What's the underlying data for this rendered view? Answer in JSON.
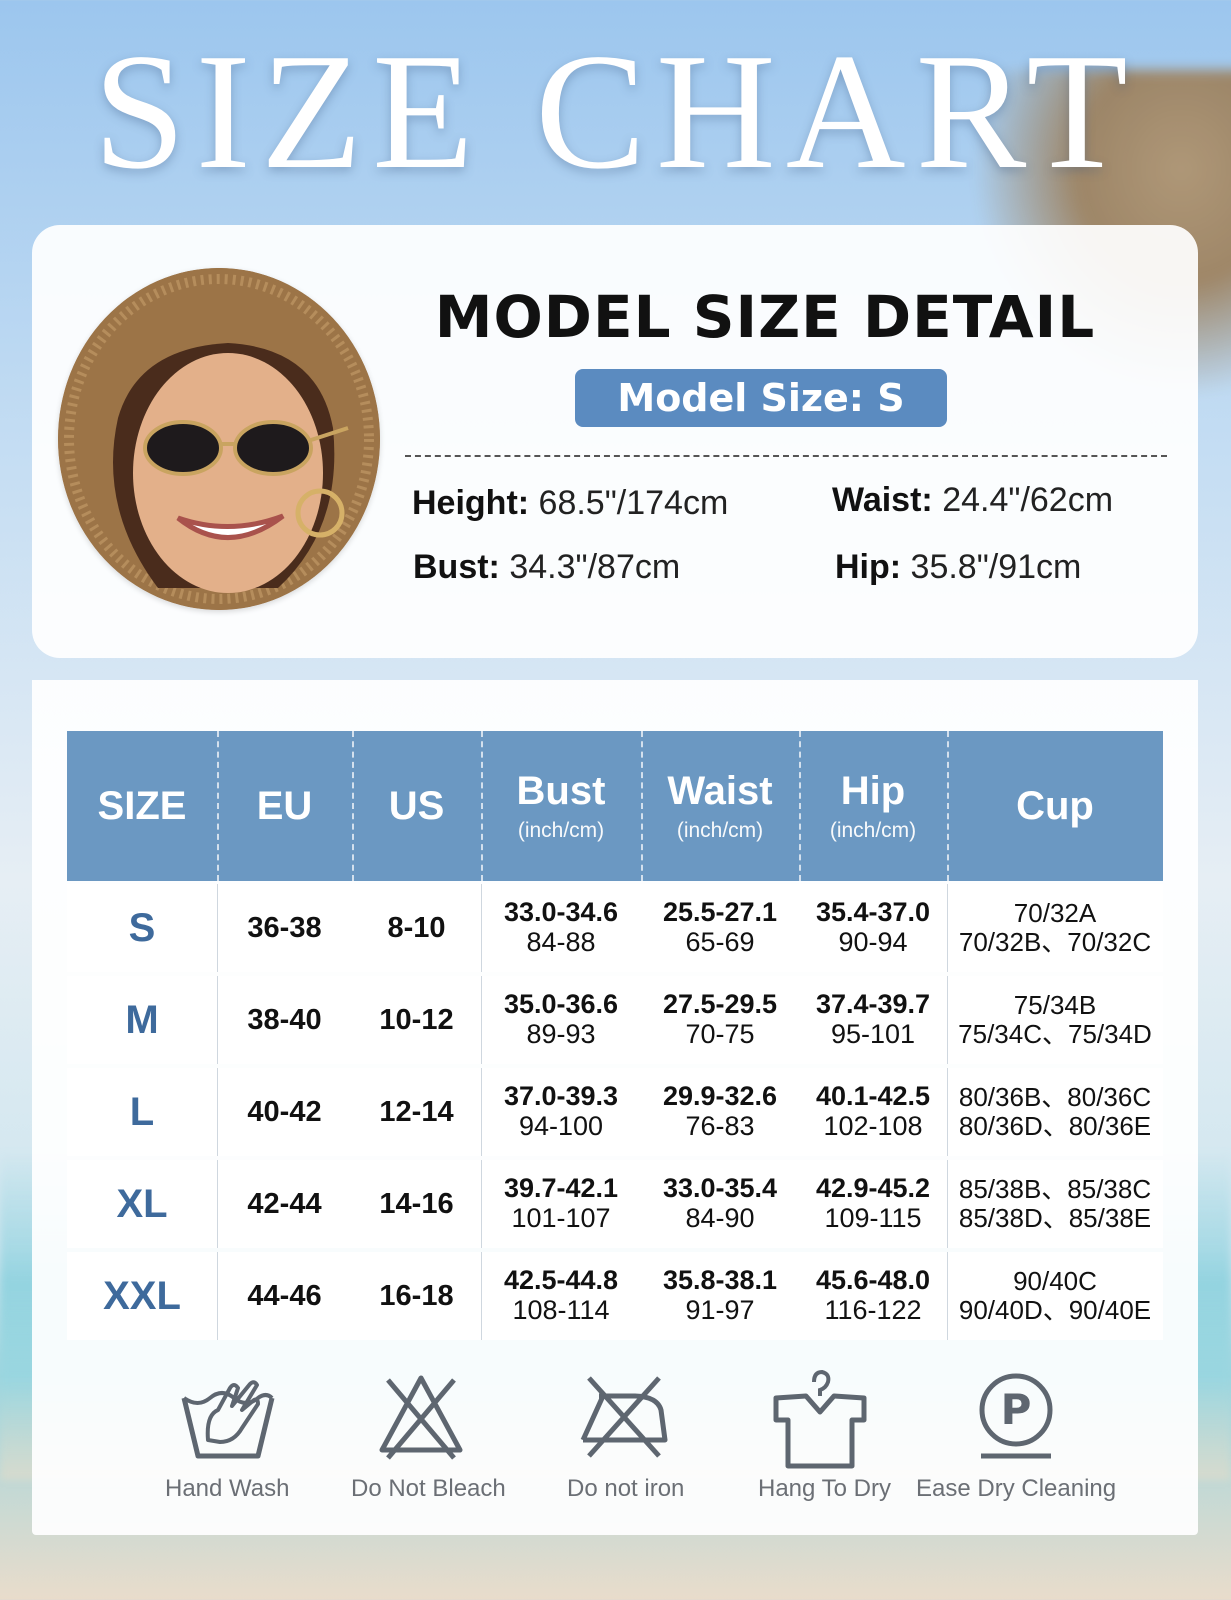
{
  "title": "SIZE CHART",
  "model": {
    "heading": "MODEL SIZE DETAIL",
    "size_badge": "Model Size: S",
    "measurements": [
      {
        "label": "Height:",
        "value": "68.5\"/174cm"
      },
      {
        "label": "Waist:",
        "value": "24.4\"/62cm"
      },
      {
        "label": "Bust:",
        "value": "34.3\"/87cm"
      },
      {
        "label": "Hip:",
        "value": "35.8\"/91cm"
      }
    ]
  },
  "table": {
    "headers": [
      {
        "main": "SIZE",
        "sub": ""
      },
      {
        "main": "EU",
        "sub": ""
      },
      {
        "main": "US",
        "sub": ""
      },
      {
        "main": "Bust",
        "sub": "(inch/cm)"
      },
      {
        "main": "Waist",
        "sub": "(inch/cm)"
      },
      {
        "main": "Hip",
        "sub": "(inch/cm)"
      },
      {
        "main": "Cup",
        "sub": ""
      }
    ],
    "rows": [
      {
        "size": "S",
        "eu": "36-38",
        "us": "8-10",
        "bust_in": "33.0-34.6",
        "bust_cm": "84-88",
        "waist_in": "25.5-27.1",
        "waist_cm": "65-69",
        "hip_in": "35.4-37.0",
        "hip_cm": "90-94",
        "cup1": "70/32A",
        "cup2": "70/32B、70/32C"
      },
      {
        "size": "M",
        "eu": "38-40",
        "us": "10-12",
        "bust_in": "35.0-36.6",
        "bust_cm": "89-93",
        "waist_in": "27.5-29.5",
        "waist_cm": "70-75",
        "hip_in": "37.4-39.7",
        "hip_cm": "95-101",
        "cup1": "75/34B",
        "cup2": "75/34C、75/34D"
      },
      {
        "size": "L",
        "eu": "40-42",
        "us": "12-14",
        "bust_in": "37.0-39.3",
        "bust_cm": "94-100",
        "waist_in": "29.9-32.6",
        "waist_cm": "76-83",
        "hip_in": "40.1-42.5",
        "hip_cm": "102-108",
        "cup1": "80/36B、80/36C",
        "cup2": "80/36D、80/36E"
      },
      {
        "size": "XL",
        "eu": "42-44",
        "us": "14-16",
        "bust_in": "39.7-42.1",
        "bust_cm": "101-107",
        "waist_in": "33.0-35.4",
        "waist_cm": "84-90",
        "hip_in": "42.9-45.2",
        "hip_cm": "109-115",
        "cup1": "85/38B、85/38C",
        "cup2": "85/38D、85/38E"
      },
      {
        "size": "XXL",
        "eu": "44-46",
        "us": "16-18",
        "bust_in": "42.5-44.8",
        "bust_cm": "108-114",
        "waist_in": "35.8-38.1",
        "waist_cm": "91-97",
        "hip_in": "45.6-48.0",
        "hip_cm": "116-122",
        "cup1": "90/40C",
        "cup2": "90/40D、90/40E"
      }
    ]
  },
  "care": [
    {
      "icon": "hand-wash-icon",
      "label": "Hand Wash"
    },
    {
      "icon": "do-not-bleach-icon",
      "label": "Do Not Bleach"
    },
    {
      "icon": "do-not-iron-icon",
      "label": "Do not iron"
    },
    {
      "icon": "hang-to-dry-icon",
      "label": "Hang To Dry"
    },
    {
      "icon": "dry-cleaning-icon",
      "label": "Ease Dry Cleaning"
    }
  ],
  "colors": {
    "header_blue": "#6b98c2",
    "badge_blue": "#5b8bc0",
    "size_text": "#3e6a9c",
    "icon_gray": "#5e6670"
  }
}
